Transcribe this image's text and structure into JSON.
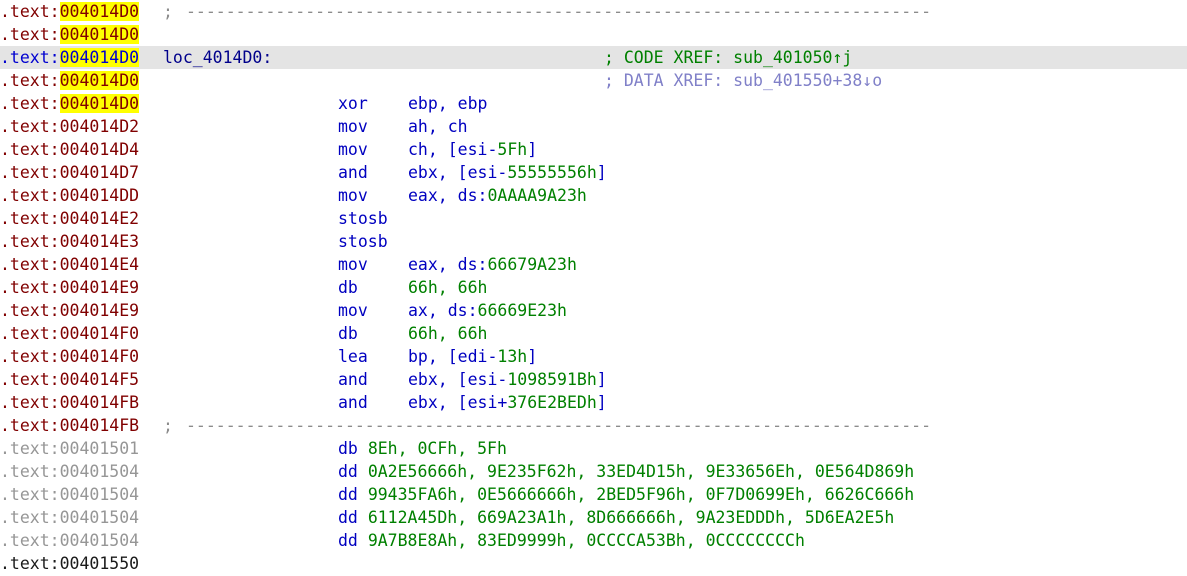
{
  "view": {
    "kind": "disassembly-listing",
    "segment": ".text",
    "colors": {
      "address": "#800000",
      "address_undefined": "#969696",
      "address_selected": "#0000d0",
      "highlight": "#ffff00",
      "selection_row": "#e4e4e4",
      "mnemonic": "#0000c0",
      "number": "#008000",
      "comment": "#8b8b8b",
      "code_xref": "#008000",
      "data_xref": "#8080c8",
      "label": "#00008b"
    },
    "highlighted_token": "004014D0",
    "selected_line_index": 2
  },
  "lines": [
    {
      "seg": ".text:",
      "addr": "004014D0",
      "addr_style": "code",
      "highlight": true,
      "selected": false,
      "kind": "separator",
      "semi": ";",
      "dashes": "---------------------------------------------------------------------------"
    },
    {
      "seg": ".text:",
      "addr": "004014D0",
      "addr_style": "code",
      "highlight": true,
      "selected": false,
      "kind": "blank"
    },
    {
      "seg": ".text:",
      "addr": "004014D0",
      "addr_style": "code",
      "highlight": true,
      "selected": true,
      "kind": "label",
      "label": "loc_4014D0:",
      "xref_kind": "code",
      "xref": "; CODE XREF: sub_401050↑j"
    },
    {
      "seg": ".text:",
      "addr": "004014D0",
      "addr_style": "code",
      "highlight": true,
      "selected": false,
      "kind": "xref-only",
      "xref_kind": "data",
      "xref": "; DATA XREF: sub_401550+38↓o"
    },
    {
      "seg": ".text:",
      "addr": "004014D0",
      "addr_style": "code",
      "highlight": true,
      "selected": false,
      "kind": "insn",
      "mnem": "xor",
      "ops": [
        {
          "t": "ebp, ebp",
          "c": "oper"
        }
      ]
    },
    {
      "seg": ".text:",
      "addr": "004014D2",
      "addr_style": "code",
      "highlight": false,
      "selected": false,
      "kind": "insn",
      "mnem": "mov",
      "ops": [
        {
          "t": "ah, ch",
          "c": "oper"
        }
      ]
    },
    {
      "seg": ".text:",
      "addr": "004014D4",
      "addr_style": "code",
      "highlight": false,
      "selected": false,
      "kind": "insn",
      "mnem": "mov",
      "ops": [
        {
          "t": "ch, [esi-",
          "c": "oper"
        },
        {
          "t": "5Fh",
          "c": "num"
        },
        {
          "t": "]",
          "c": "oper"
        }
      ]
    },
    {
      "seg": ".text:",
      "addr": "004014D7",
      "addr_style": "code",
      "highlight": false,
      "selected": false,
      "kind": "insn",
      "mnem": "and",
      "ops": [
        {
          "t": "ebx, [esi-",
          "c": "oper"
        },
        {
          "t": "55555556h",
          "c": "num"
        },
        {
          "t": "]",
          "c": "oper"
        }
      ]
    },
    {
      "seg": ".text:",
      "addr": "004014DD",
      "addr_style": "code",
      "highlight": false,
      "selected": false,
      "kind": "insn",
      "mnem": "mov",
      "ops": [
        {
          "t": "eax, ds:",
          "c": "oper"
        },
        {
          "t": "0AAAA9A23h",
          "c": "num"
        }
      ]
    },
    {
      "seg": ".text:",
      "addr": "004014E2",
      "addr_style": "code",
      "highlight": false,
      "selected": false,
      "kind": "insn",
      "mnem": "stosb",
      "ops": []
    },
    {
      "seg": ".text:",
      "addr": "004014E3",
      "addr_style": "code",
      "highlight": false,
      "selected": false,
      "kind": "insn",
      "mnem": "stosb",
      "ops": []
    },
    {
      "seg": ".text:",
      "addr": "004014E4",
      "addr_style": "code",
      "highlight": false,
      "selected": false,
      "kind": "insn",
      "mnem": "mov",
      "ops": [
        {
          "t": "eax, ds:",
          "c": "oper"
        },
        {
          "t": "66679A23h",
          "c": "num"
        }
      ]
    },
    {
      "seg": ".text:",
      "addr": "004014E9",
      "addr_style": "code",
      "highlight": false,
      "selected": false,
      "kind": "insn",
      "mnem": "db",
      "ops": [
        {
          "t": "66h, 66h",
          "c": "num"
        }
      ]
    },
    {
      "seg": ".text:",
      "addr": "004014E9",
      "addr_style": "code",
      "highlight": false,
      "selected": false,
      "kind": "insn",
      "mnem": "mov",
      "ops": [
        {
          "t": "ax, ds:",
          "c": "oper"
        },
        {
          "t": "66669E23h",
          "c": "num"
        }
      ]
    },
    {
      "seg": ".text:",
      "addr": "004014F0",
      "addr_style": "code",
      "highlight": false,
      "selected": false,
      "kind": "insn",
      "mnem": "db",
      "ops": [
        {
          "t": "66h, 66h",
          "c": "num"
        }
      ]
    },
    {
      "seg": ".text:",
      "addr": "004014F0",
      "addr_style": "code",
      "highlight": false,
      "selected": false,
      "kind": "insn",
      "mnem": "lea",
      "ops": [
        {
          "t": "bp, [edi-",
          "c": "oper"
        },
        {
          "t": "13h",
          "c": "num"
        },
        {
          "t": "]",
          "c": "oper"
        }
      ]
    },
    {
      "seg": ".text:",
      "addr": "004014F5",
      "addr_style": "code",
      "highlight": false,
      "selected": false,
      "kind": "insn",
      "mnem": "and",
      "ops": [
        {
          "t": "ebx, [esi-",
          "c": "oper"
        },
        {
          "t": "1098591Bh",
          "c": "num"
        },
        {
          "t": "]",
          "c": "oper"
        }
      ]
    },
    {
      "seg": ".text:",
      "addr": "004014FB",
      "addr_style": "code",
      "highlight": false,
      "selected": false,
      "kind": "insn",
      "mnem": "and",
      "ops": [
        {
          "t": "ebx, [esi+",
          "c": "oper"
        },
        {
          "t": "376E2BEDh",
          "c": "num"
        },
        {
          "t": "]",
          "c": "oper"
        }
      ]
    },
    {
      "seg": ".text:",
      "addr": "004014FB",
      "addr_style": "code",
      "highlight": false,
      "selected": false,
      "kind": "separator",
      "semi": ";",
      "dashes": "---------------------------------------------------------------------------"
    },
    {
      "seg": ".text:",
      "addr": "00401501",
      "addr_style": "undefined",
      "highlight": false,
      "selected": false,
      "kind": "data",
      "mnem": "db",
      "values": "8Eh, 0CFh, 5Fh"
    },
    {
      "seg": ".text:",
      "addr": "00401504",
      "addr_style": "undefined",
      "highlight": false,
      "selected": false,
      "kind": "data",
      "mnem": "dd",
      "values": "0A2E56666h, 9E235F62h, 33ED4D15h, 9E33656Eh, 0E564D869h"
    },
    {
      "seg": ".text:",
      "addr": "00401504",
      "addr_style": "undefined",
      "highlight": false,
      "selected": false,
      "kind": "data",
      "mnem": "dd",
      "values": "99435FA6h, 0E5666666h, 2BED5F96h, 0F7D0699Eh, 6626C666h"
    },
    {
      "seg": ".text:",
      "addr": "00401504",
      "addr_style": "undefined",
      "highlight": false,
      "selected": false,
      "kind": "data",
      "mnem": "dd",
      "values": "6112A45Dh, 669A23A1h, 8D666666h, 9A23EDDDh, 5D6EA2E5h"
    },
    {
      "seg": ".text:",
      "addr": "00401504",
      "addr_style": "undefined",
      "highlight": false,
      "selected": false,
      "kind": "data",
      "mnem": "dd",
      "values": "9A7B8E8Ah, 83ED9999h, 0CCCCA53Bh, 0CCCCCCCCh"
    },
    {
      "seg": ".text:",
      "addr": "00401550",
      "addr_style": "defined",
      "highlight": false,
      "selected": false,
      "kind": "blank"
    }
  ]
}
